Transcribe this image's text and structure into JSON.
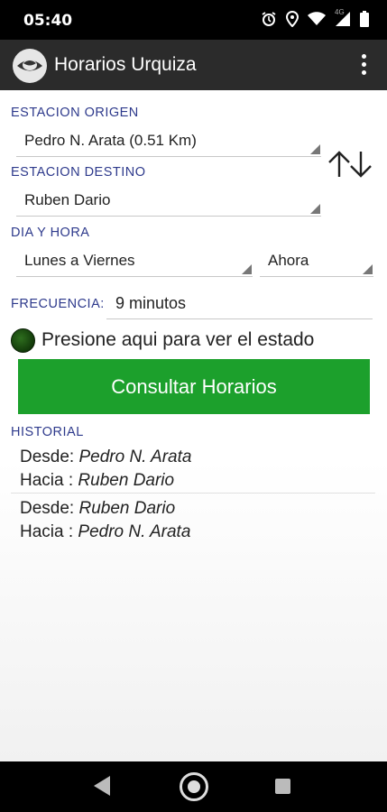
{
  "status_bar": {
    "time": "05:40",
    "icons": [
      "alarm-icon",
      "location-icon",
      "wifi-icon",
      "signal-icon",
      "battery-icon"
    ],
    "network": "4G"
  },
  "app_bar": {
    "title": "Horarios Urquiza",
    "logo": "eye-logo-icon",
    "menu": "overflow-menu-icon"
  },
  "form": {
    "origin_label": "ESTACION ORIGEN",
    "origin_value": "Pedro N. Arata (0.51 Km)",
    "destination_label": "ESTACION DESTINO",
    "destination_value": "Ruben Dario",
    "swap_icon": "swap-arrows-icon",
    "day_time_label": "DIA Y HORA",
    "day_value": "Lunes a Viernes",
    "time_value": "Ahora",
    "frequency_label": "FRECUENCIA:",
    "frequency_value": "9 minutos"
  },
  "status": {
    "text": "Presione aqui para ver el estado",
    "indicator_color": "#1b4d0f"
  },
  "consult_button": {
    "label": "Consultar Horarios",
    "color": "#1ca02c"
  },
  "history": {
    "label": "HISTORIAL",
    "items": [
      {
        "from_prefix": "Desde:",
        "from": "Pedro N. Arata",
        "to_prefix": "Hacia :",
        "to": "Ruben Dario"
      },
      {
        "from_prefix": "Desde:",
        "from": "Ruben Dario",
        "to_prefix": "Hacia :",
        "to": "Pedro N. Arata"
      }
    ]
  },
  "nav_bar": {
    "buttons": [
      "back-icon",
      "home-icon",
      "recents-icon"
    ]
  },
  "colors": {
    "label_blue": "#2e3a8c",
    "app_bar": "#2b2b2b"
  }
}
